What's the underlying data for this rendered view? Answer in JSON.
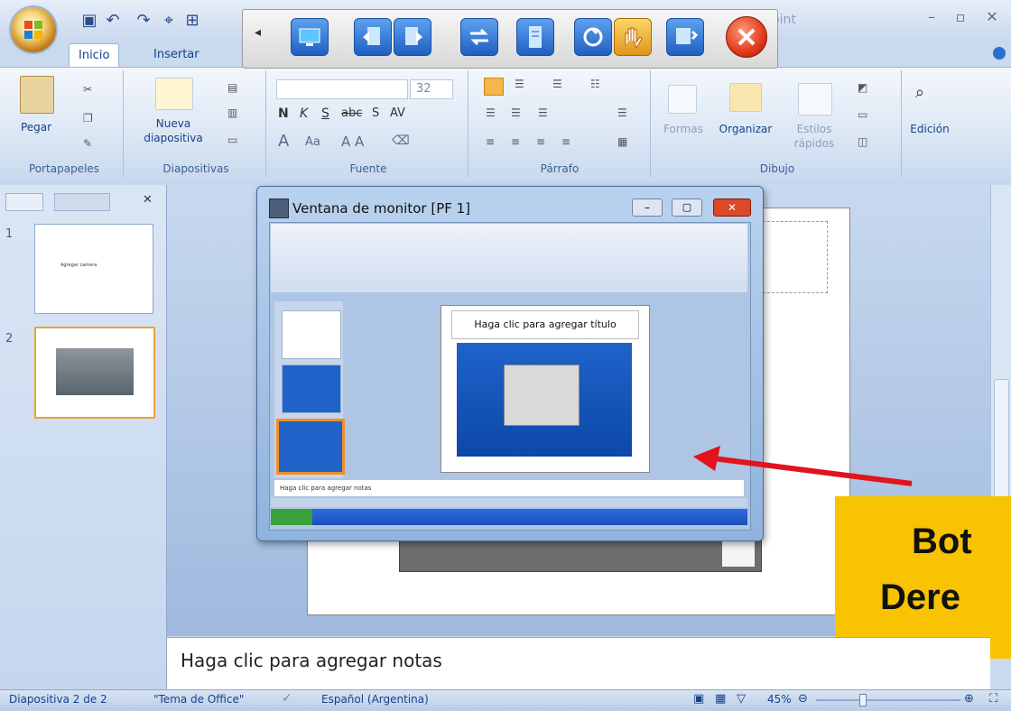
{
  "window": {
    "title_partial": "oint"
  },
  "tabs": [
    {
      "label": "Inicio"
    },
    {
      "label": "Insertar"
    }
  ],
  "ribbon": {
    "groups": {
      "portapapeles": {
        "label": "Portapapeles",
        "paste_label": "Pegar"
      },
      "diapositivas": {
        "label": "Diapositivas",
        "new_slide_label_1": "Nueva",
        "new_slide_label_2": "diapositiva"
      },
      "fuente": {
        "label": "Fuente",
        "font_size": "32"
      },
      "parrafo": {
        "label": "Párrafo"
      },
      "dibujo": {
        "label": "Dibujo",
        "formas": "Formas",
        "organizar": "Organizar",
        "estilos_1": "Estilos",
        "estilos_2": "rápidos"
      },
      "edicion": {
        "label": "Edición"
      }
    }
  },
  "slides": [
    {
      "number": "1",
      "text": "Agregar camera"
    },
    {
      "number": "2"
    }
  ],
  "monitor_window": {
    "title": "Ventana de monitor [PF 1]",
    "inner_slide_title": "Haga clic para agregar título",
    "inner_notes": "Haga clic para agregar notas"
  },
  "notes": {
    "placeholder": "Haga clic para agregar notas"
  },
  "callout": {
    "line1": "Bot",
    "line2": "Dere"
  },
  "status": {
    "slide_info": "Diapositiva 2 de 2",
    "theme": "\"Tema de Office\"",
    "language": "Español (Argentina)",
    "zoom": "45%"
  },
  "colors": {
    "accent": "#15428b",
    "callout_bg": "#f8c300",
    "arrow": "#e0141a"
  }
}
